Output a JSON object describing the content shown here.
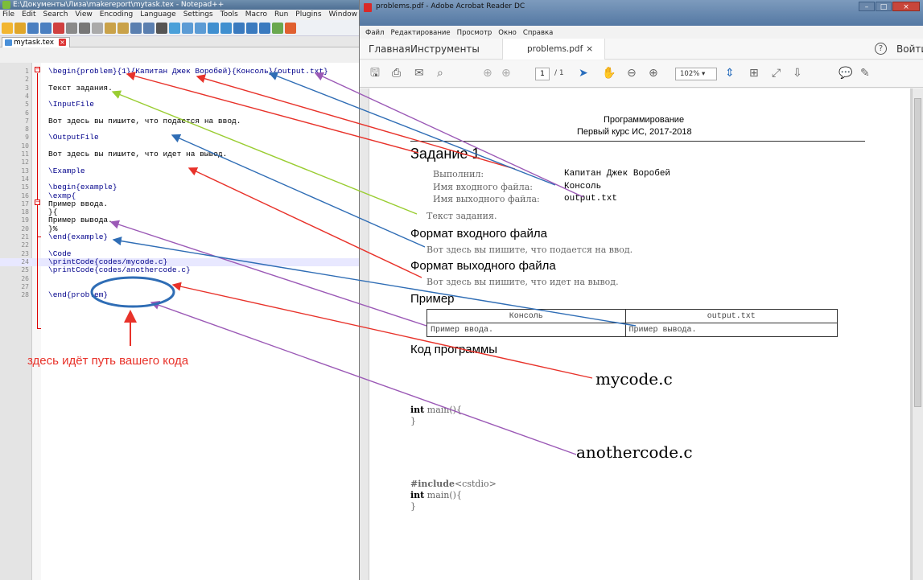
{
  "notepad": {
    "title": "E:\\Документы\\Лиза\\makereport\\mytask.tex - Notepad++",
    "menu": [
      "File",
      "Edit",
      "Search",
      "View",
      "Encoding",
      "Language",
      "Settings",
      "Tools",
      "Macro",
      "Run",
      "Plugins",
      "Window",
      "?"
    ],
    "tab_label": "mytask.tex",
    "lines": [
      {
        "n": "1",
        "text": "\\begin{problem}{1}{Капитан Джек Воробей}{Консоль}{output.txt}"
      },
      {
        "n": "2",
        "text": ""
      },
      {
        "n": "3",
        "text": "Текст задания."
      },
      {
        "n": "4",
        "text": ""
      },
      {
        "n": "5",
        "text": "\\InputFile"
      },
      {
        "n": "6",
        "text": ""
      },
      {
        "n": "7",
        "text": "Вот здесь вы пишите, что подается на ввод."
      },
      {
        "n": "8",
        "text": ""
      },
      {
        "n": "9",
        "text": "\\OutputFile"
      },
      {
        "n": "10",
        "text": ""
      },
      {
        "n": "11",
        "text": "Вот здесь вы пишите, что идет на вывод."
      },
      {
        "n": "12",
        "text": ""
      },
      {
        "n": "13",
        "text": "\\Example"
      },
      {
        "n": "14",
        "text": ""
      },
      {
        "n": "15",
        "text": "\\begin{example}"
      },
      {
        "n": "16",
        "text": "\\exmp{"
      },
      {
        "n": "17",
        "text": "Пример ввода."
      },
      {
        "n": "18",
        "text": "}{"
      },
      {
        "n": "19",
        "text": "Пример вывода."
      },
      {
        "n": "20",
        "text": "}%"
      },
      {
        "n": "21",
        "text": "\\end{example}"
      },
      {
        "n": "22",
        "text": ""
      },
      {
        "n": "23",
        "text": "\\Code"
      },
      {
        "n": "24",
        "text": "\\printCode{codes/mycode.c}"
      },
      {
        "n": "25",
        "text": "\\printCode{codes/anothercode.c}"
      },
      {
        "n": "26",
        "text": ""
      },
      {
        "n": "27",
        "text": ""
      },
      {
        "n": "28",
        "text": "\\end{problem}"
      }
    ],
    "annotation": "здесь идёт путь вашего кода"
  },
  "acrobat": {
    "title": "problems.pdf - Adobe Acrobat Reader DC",
    "menu": [
      "Файл",
      "Редактирование",
      "Просмотр",
      "Окно",
      "Справка"
    ],
    "tab_home": "Главная",
    "tab_tools": "Инструменты",
    "doc_tab": "problems.pdf",
    "sign_in": "Войти",
    "page_current": "1",
    "page_total": "/ 1",
    "zoom": "102%",
    "pdf": {
      "header_line1": "Программирование",
      "header_line2": "Первый курс ИС, 2017-2018",
      "task_title": "Задание 1",
      "meta": [
        {
          "label": "Выполнил:",
          "value": "Капитан Джек Воробей"
        },
        {
          "label": "Имя входного файла:",
          "value": "Консоль"
        },
        {
          "label": "Имя выходного файла:",
          "value": "output.txt"
        }
      ],
      "task_text": "Текст задания.",
      "input_heading": "Формат входного файла",
      "input_text": "Вот здесь вы пишите, что подается на ввод.",
      "output_heading": "Формат выходного файла",
      "output_text": "Вот здесь вы пишите, что идет на вывод.",
      "example_heading": "Пример",
      "table_headers": [
        "Консоль",
        "output.txt"
      ],
      "table_row": [
        "Пример ввода.",
        "Пример вывода."
      ],
      "code_heading": "Код программы",
      "code1_label": "mycode.c",
      "code1_kw": "int",
      "code1_line1": "main(){",
      "code1_line2": "}",
      "code2_label": "anothercode.c",
      "code2_include_kw": "#include",
      "code2_include_arg": "<cstdio>",
      "code2_kw": "int",
      "code2_line1": "main(){",
      "code2_line2": "}"
    }
  },
  "colors": {
    "arrow_red": "#e8322a",
    "arrow_blue": "#2f6db5",
    "arrow_purple": "#9b59b6",
    "arrow_green": "#9acd32"
  }
}
